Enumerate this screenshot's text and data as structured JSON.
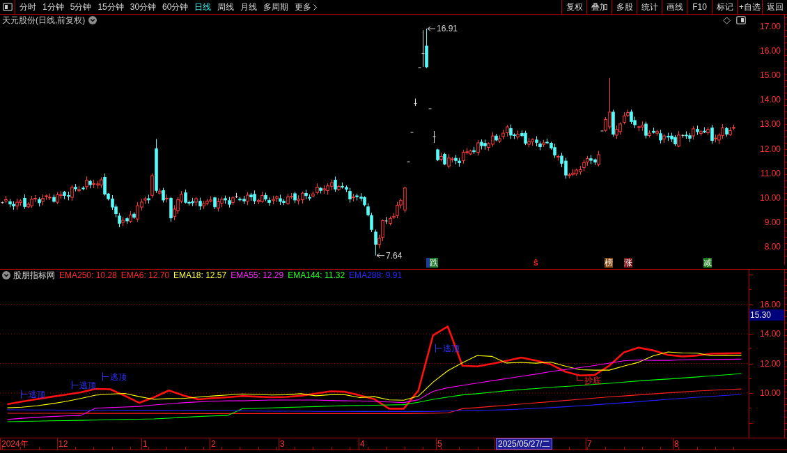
{
  "toolbar": {
    "periods": [
      {
        "label": "分时",
        "selected": false
      },
      {
        "label": "1分钟",
        "selected": false
      },
      {
        "label": "5分钟",
        "selected": false
      },
      {
        "label": "15分钟",
        "selected": false
      },
      {
        "label": "30分钟",
        "selected": false
      },
      {
        "label": "60分钟",
        "selected": false
      },
      {
        "label": "日线",
        "selected": true
      },
      {
        "label": "周线",
        "selected": false
      },
      {
        "label": "月线",
        "selected": false
      },
      {
        "label": "多周期",
        "selected": false
      }
    ],
    "more": {
      "label": "更多"
    },
    "actions": [
      "复权",
      "叠加",
      "多股",
      "统计",
      "画线",
      "F10",
      "标记",
      "+自选",
      "返回"
    ]
  },
  "price_chart": {
    "title": "天元股份(日线,前复权)",
    "axis_labels": [
      "17.00",
      "16.00",
      "15.00",
      "14.00",
      "13.00",
      "12.00",
      "11.00",
      "10.00",
      "9.00",
      "8.00"
    ],
    "extremes": [
      {
        "kind": "high",
        "text": "16.91"
      },
      {
        "kind": "low",
        "text": "7.64"
      }
    ],
    "signals": [
      {
        "kind": "tag",
        "color": "#1c3c9c"
      },
      {
        "kind": "tag",
        "text": "跌",
        "color": "#1a7a2a"
      },
      {
        "kind": "symbol",
        "text": "ŝ",
        "color": "#ff2020"
      },
      {
        "kind": "tag",
        "text": "榜",
        "color": "#8a4a14"
      },
      {
        "kind": "tag",
        "text": "涨",
        "color": "#7a1418"
      },
      {
        "kind": "tag",
        "text": "减",
        "color": "#1a7a1a"
      }
    ]
  },
  "indicator": {
    "name": "股朋指标网",
    "legend": [
      {
        "text": "EMA250: 10.28",
        "color": "#ff2a2a"
      },
      {
        "text": "EMA6: 12.70",
        "color": "#ff2a2a"
      },
      {
        "text": "EMA18: 12.57",
        "color": "#ffff3c"
      },
      {
        "text": "EMA55: 12.29",
        "color": "#ff28ff"
      },
      {
        "text": "EMA144: 11.32",
        "color": "#28ff28"
      },
      {
        "text": "EMA288: 9.91",
        "color": "#2828ff"
      }
    ],
    "cursor_value": "15.30",
    "chart_data": {
      "type": "line",
      "categories": [
        null,
        null,
        null,
        null,
        null,
        null,
        null,
        null,
        null,
        null,
        null,
        null,
        null,
        null,
        null,
        null,
        null,
        null,
        null,
        null,
        null,
        null,
        null,
        null,
        null,
        null,
        null,
        null,
        null,
        null,
        null,
        null,
        null,
        null,
        null,
        null,
        null,
        null,
        null,
        null,
        null,
        null,
        null,
        null,
        null,
        null,
        null,
        null,
        null,
        null,
        null
      ],
      "ylim": [
        6.99,
        18.38
      ],
      "yticks": [
        {
          "value": 16,
          "label": "16.00"
        },
        {
          "value": 14,
          "label": "14.00"
        },
        {
          "value": 12,
          "label": "12.00"
        },
        {
          "value": 10,
          "label": "10.00"
        }
      ],
      "grid": true,
      "series": [
        {
          "color": "#ff2020",
          "values": [
            8.64,
            8.64,
            8.64,
            8.64,
            8.64,
            8.63,
            8.63,
            8.63,
            8.63,
            8.63,
            8.63,
            8.63,
            8.62,
            8.62,
            8.62,
            8.62,
            8.62,
            8.62,
            8.62,
            8.62,
            8.62,
            8.62,
            8.62,
            8.62,
            8.62,
            8.62,
            8.62,
            8.62,
            8.63,
            8.64,
            8.66,
            8.95,
            9.02,
            9.1,
            9.18,
            9.26,
            9.34,
            9.42,
            9.5,
            9.58,
            9.66,
            9.74,
            9.81,
            9.88,
            9.95,
            10.02,
            10.08,
            10.14,
            10.19,
            10.24,
            10.28
          ]
        },
        {
          "color": "#ff1010",
          "values": [
            9.25,
            9.43,
            9.59,
            9.75,
            9.9,
            10.05,
            10.28,
            10.26,
            9.82,
            9.34,
            9.72,
            10.18,
            9.84,
            9.58,
            9.66,
            9.72,
            9.8,
            9.76,
            9.72,
            9.74,
            9.82,
            9.97,
            10.12,
            10.09,
            9.85,
            9.59,
            8.95,
            8.95,
            10.17,
            13.9,
            14.5,
            11.85,
            11.8,
            11.98,
            12.18,
            12.4,
            12.2,
            11.95,
            11.45,
            11.19,
            11.22,
            11.85,
            12.75,
            13.07,
            12.88,
            12.58,
            12.48,
            12.54,
            12.66,
            12.68,
            12.7
          ]
        },
        {
          "color": "#ffff00",
          "values": [
            9.01,
            9.05,
            9.14,
            9.28,
            9.44,
            9.64,
            9.86,
            9.93,
            9.98,
            9.76,
            9.58,
            9.63,
            9.64,
            9.73,
            9.81,
            9.87,
            9.94,
            9.91,
            9.87,
            9.89,
            9.96,
            9.82,
            9.89,
            9.89,
            9.7,
            9.76,
            9.54,
            9.52,
            9.8,
            10.74,
            11.51,
            12.05,
            12.53,
            12.48,
            12.03,
            12.07,
            12.02,
            12.1,
            11.83,
            11.58,
            11.55,
            11.55,
            11.83,
            12.08,
            12.52,
            12.78,
            12.71,
            12.7,
            12.52,
            12.54,
            12.55
          ]
        },
        {
          "color": "#ff00ff",
          "values": [
            8.22,
            8.3,
            8.36,
            8.42,
            8.46,
            8.49,
            8.98,
            9.02,
            9.06,
            9.1,
            9.2,
            9.27,
            9.35,
            9.41,
            9.45,
            9.48,
            9.48,
            9.51,
            9.53,
            9.53,
            9.53,
            9.53,
            9.5,
            9.48,
            9.47,
            9.44,
            9.4,
            9.36,
            9.55,
            10.12,
            10.36,
            10.52,
            10.67,
            10.83,
            10.98,
            11.13,
            11.28,
            11.45,
            11.59,
            11.72,
            11.86,
            12.03,
            12.18,
            12.24,
            12.21,
            12.21,
            12.25,
            12.26,
            12.27,
            12.28,
            12.29
          ]
        },
        {
          "color": "#00ff00",
          "values": [
            8.07,
            8.09,
            8.11,
            8.13,
            8.14,
            8.16,
            8.18,
            8.2,
            8.22,
            8.24,
            8.26,
            8.31,
            8.36,
            8.42,
            8.46,
            8.49,
            8.94,
            8.97,
            9.0,
            9.03,
            9.06,
            9.09,
            9.12,
            9.15,
            9.17,
            9.18,
            9.2,
            9.22,
            9.38,
            9.58,
            9.73,
            9.88,
            9.96,
            10.06,
            10.16,
            10.24,
            10.31,
            10.39,
            10.45,
            10.51,
            10.59,
            10.66,
            10.74,
            10.82,
            10.89,
            10.95,
            11.02,
            11.09,
            11.17,
            11.24,
            11.32
          ]
        },
        {
          "color": "#2020ff",
          "values": [
            8.87,
            8.87,
            8.86,
            8.86,
            8.85,
            8.85,
            8.84,
            8.84,
            8.83,
            8.83,
            8.82,
            8.82,
            8.81,
            8.81,
            8.8,
            8.8,
            8.79,
            8.79,
            8.78,
            8.78,
            8.78,
            8.77,
            8.77,
            8.77,
            8.76,
            8.76,
            8.76,
            8.76,
            8.76,
            8.77,
            8.79,
            8.8,
            8.82,
            8.85,
            8.88,
            8.92,
            8.97,
            9.02,
            9.08,
            9.14,
            9.21,
            9.28,
            9.35,
            9.42,
            9.5,
            9.58,
            9.65,
            9.72,
            9.78,
            9.85,
            9.91
          ]
        }
      ],
      "annotations": [
        {
          "text": "逃顶"
        },
        {
          "text": "逃顶"
        },
        {
          "text": "逃顶"
        },
        {
          "text": "逃顶"
        },
        {
          "text": "抄底"
        }
      ]
    }
  },
  "time_axis": [
    {
      "text": "2024年",
      "kind": "month"
    },
    {
      "text": "12",
      "kind": "month"
    },
    {
      "text": "1",
      "kind": "month"
    },
    {
      "text": "2",
      "kind": "month"
    },
    {
      "text": "3",
      "kind": "month"
    },
    {
      "text": "4",
      "kind": "month"
    },
    {
      "text": "5",
      "kind": "month"
    },
    {
      "text": "2025/05/27/二",
      "kind": "cursor"
    },
    {
      "text": "7",
      "kind": "month"
    },
    {
      "text": "8",
      "kind": "month"
    }
  ]
}
